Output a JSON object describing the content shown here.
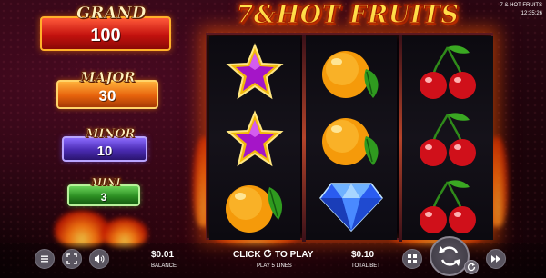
{
  "game": {
    "title": "7&HOT FRUITS",
    "status_title": "7 & HOT FRUITS",
    "clock": "12:35:26"
  },
  "jackpots": [
    {
      "name": "grand",
      "label": "GRAND",
      "value": "100",
      "color": "#d8231f"
    },
    {
      "name": "major",
      "label": "MAJOR",
      "value": "30",
      "color": "#e7620c"
    },
    {
      "name": "minor",
      "label": "MINOR",
      "value": "10",
      "color": "#4a2bb2"
    },
    {
      "name": "mini",
      "label": "MINI",
      "value": "3",
      "color": "#2c8f22"
    }
  ],
  "reels": [
    [
      "star",
      "star",
      "orange"
    ],
    [
      "orange",
      "orange",
      "diamond"
    ],
    [
      "cherry",
      "cherry",
      "cherry"
    ]
  ],
  "bottom_bar": {
    "balance_value": "$0.01",
    "balance_label": "BALANCE",
    "play_text_a": "CLICK",
    "play_text_b": "TO PLAY",
    "lines_text": "PLAY 5 LINES",
    "bet_value": "$0.10",
    "bet_label": "TOTAL BET"
  },
  "icons": {
    "menu": "menu-icon",
    "fullscreen": "fullscreen-icon",
    "sound": "sound-icon",
    "paytable": "paytable-icon",
    "spin": "spin-icon",
    "autoplay": "autoplay-icon",
    "turbo": "fast-forward-icon"
  },
  "colors": {
    "accent": "#ff6a00",
    "title": "#ffe14a"
  }
}
